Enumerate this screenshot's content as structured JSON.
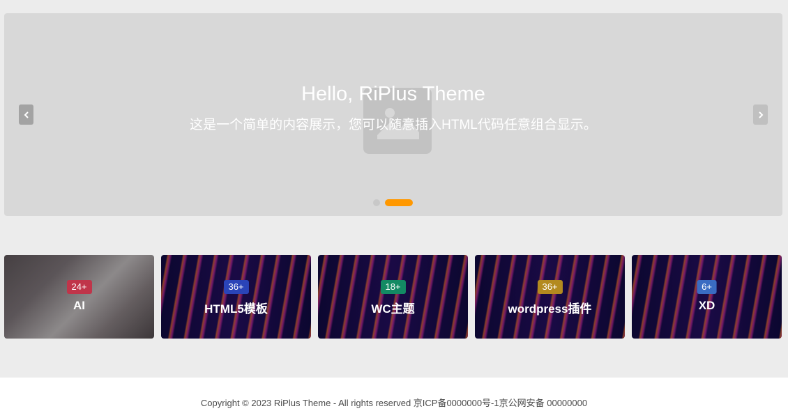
{
  "slider": {
    "title": "Hello, RiPlus Theme",
    "subtitle": "这是一个简单的内容展示，您可以随意插入HTML代码任意组合显示。",
    "prev_icon": "chevron-left-icon",
    "next_icon": "chevron-right-icon",
    "active_slide": 2,
    "slide_count": 2,
    "accent_color": "#ff9800"
  },
  "categories": [
    {
      "name": "AI",
      "count": "24+",
      "badge_color": "#c0354a"
    },
    {
      "name": "HTML5模板",
      "count": "36+",
      "badge_color": "#2a44b8"
    },
    {
      "name": "WC主题",
      "count": "18+",
      "badge_color": "#138a63"
    },
    {
      "name": "wordpress插件",
      "count": "36+",
      "badge_color": "#b38a1f"
    },
    {
      "name": "XD",
      "count": "6+",
      "badge_color": "#3a6cc2"
    }
  ],
  "footer": {
    "text": "Copyright © 2023 RiPlus Theme - All rights reserved 京ICP备0000000号-1京公网安备 00000000"
  }
}
